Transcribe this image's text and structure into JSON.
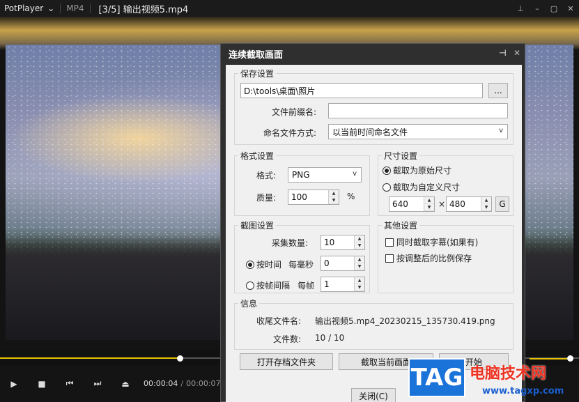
{
  "player": {
    "app_name": "PotPlayer",
    "format": "MP4",
    "title": "[3/5] 输出视频5.mp4",
    "time_current": "00:00:04",
    "time_separator": "/",
    "time_total": "00:00:07",
    "progress": 0.31,
    "volume": 0.93,
    "accent_color": "#e6c200"
  },
  "dialog": {
    "title": "连续截取画面",
    "save": {
      "group_title": "保存设置",
      "path": "D:\\tools\\桌面\\照片",
      "browse_label": "...",
      "prefix_label": "文件前缀名:",
      "prefix_value": "",
      "naming_label": "命名文件方式:",
      "naming_value": "以当前时间命名文件"
    },
    "format": {
      "group_title": "格式设置",
      "format_label": "格式:",
      "format_value": "PNG",
      "quality_label": "质量:",
      "quality_value": "100",
      "quality_unit": "%"
    },
    "size": {
      "group_title": "尺寸设置",
      "original_label": "截取为原始尺寸",
      "custom_label": "截取为自定义尺寸",
      "width": "640",
      "times": "×",
      "height": "480",
      "g_label": "G"
    },
    "capture": {
      "group_title": "截图设置",
      "count_label": "采集数量:",
      "count_value": "10",
      "by_time_label": "按时间",
      "per_ms_label": "每毫秒",
      "ms_value": "0",
      "by_frame_label": "按帧间隔",
      "per_frame_label": "每帧",
      "frame_value": "1"
    },
    "other": {
      "group_title": "其他设置",
      "subtitle_label": "同时截取字幕(如果有)",
      "ratio_label": "按调整后的比例保存"
    },
    "info": {
      "group_title": "信息",
      "last_file_label": "收尾文件名:",
      "last_file_value": "输出视频5.mp4_20230215_135730.419.png",
      "count_label": "文件数:",
      "count_value": "10 / 10"
    },
    "buttons": {
      "open_folder": "打开存档文件夹",
      "capture_current": "截取当前画面",
      "start": "开始",
      "close": "关闭(C)"
    }
  },
  "watermark": {
    "logo": "TAG",
    "name": "电脑技术网",
    "url": "www.tagxp.com"
  }
}
